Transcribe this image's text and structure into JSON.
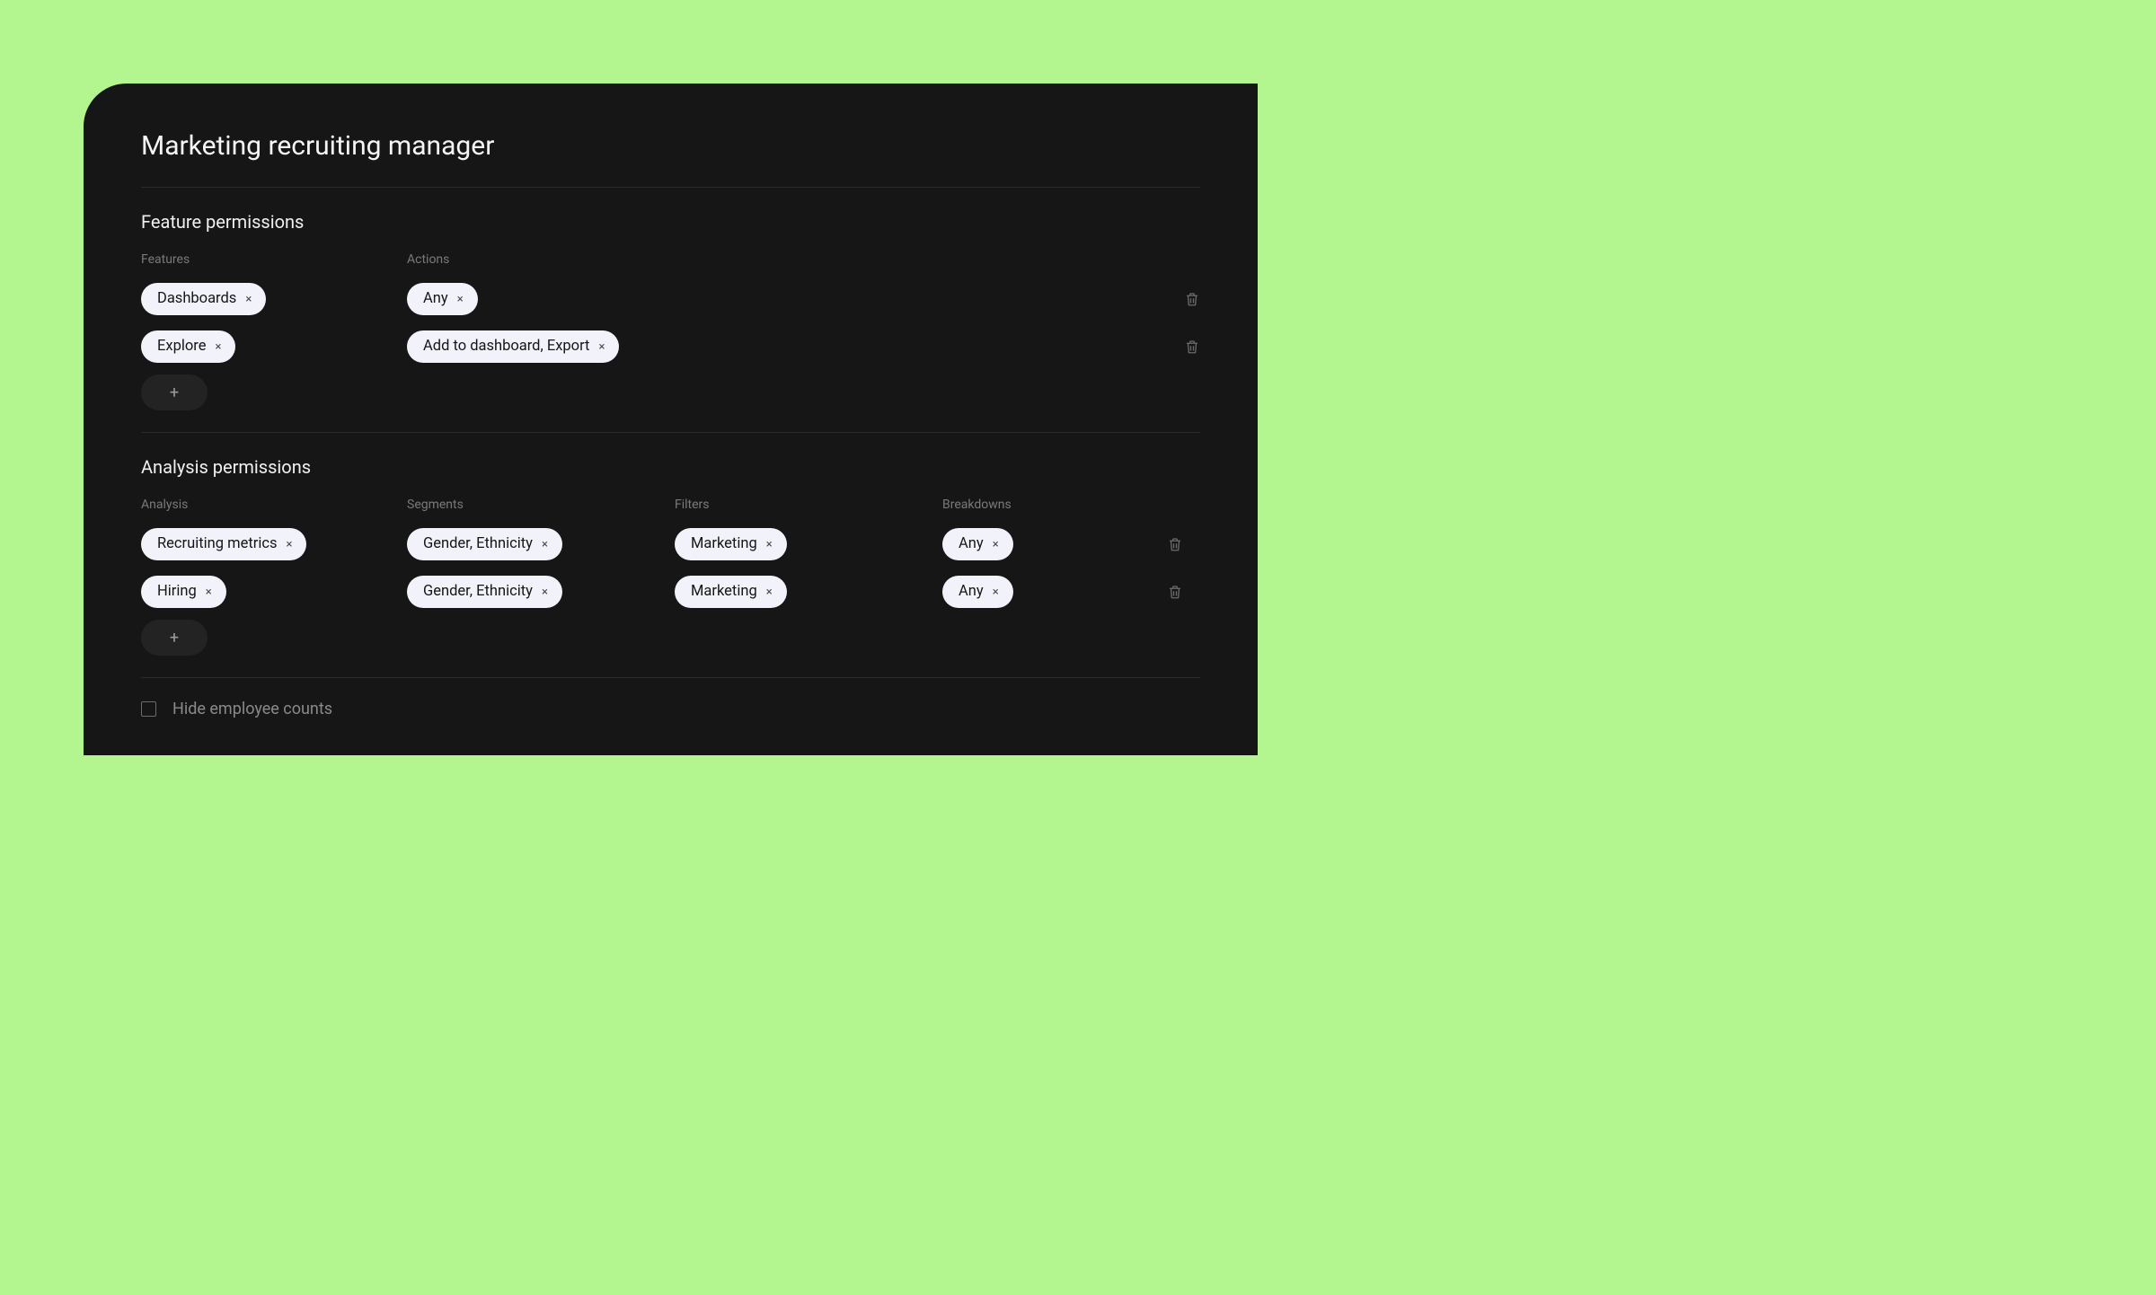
{
  "page_title": "Marketing recruiting manager",
  "feature_permissions": {
    "title": "Feature permissions",
    "columns": {
      "features": "Features",
      "actions": "Actions"
    },
    "rows": [
      {
        "feature": "Dashboards",
        "action": "Any"
      },
      {
        "feature": "Explore",
        "action": "Add to dashboard, Export"
      }
    ],
    "add_label": "+"
  },
  "analysis_permissions": {
    "title": "Analysis permissions",
    "columns": {
      "analysis": "Analysis",
      "segments": "Segments",
      "filters": "Filters",
      "breakdowns": "Breakdowns"
    },
    "rows": [
      {
        "analysis": "Recruiting metrics",
        "segments": "Gender, Ethnicity",
        "filters": "Marketing",
        "breakdowns": "Any"
      },
      {
        "analysis": "Hiring",
        "segments": "Gender, Ethnicity",
        "filters": "Marketing",
        "breakdowns": "Any"
      }
    ],
    "add_label": "+"
  },
  "hide_counts": {
    "label": "Hide employee counts",
    "checked": false
  },
  "icons": {
    "x": "×",
    "plus": "+"
  }
}
